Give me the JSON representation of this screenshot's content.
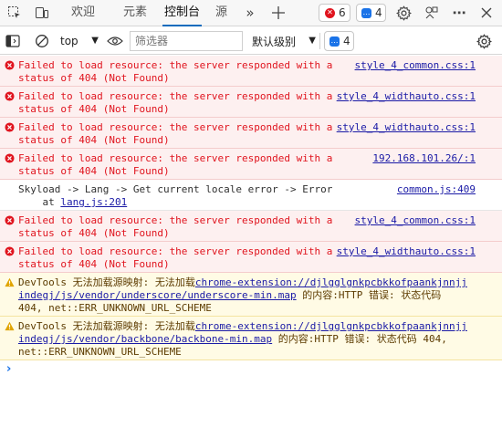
{
  "tabs": [
    {
      "label": "欢迎",
      "active": false
    },
    {
      "label": "元素",
      "active": false
    },
    {
      "label": "控制台",
      "active": true
    },
    {
      "label": "源",
      "active": false
    }
  ],
  "top_counts": {
    "errors": "6",
    "messages": "4"
  },
  "toolbar": {
    "context": "top",
    "filter_placeholder": "筛选器",
    "level": "默认级别",
    "issues": "4"
  },
  "messages": [
    {
      "kind": "error",
      "lines": [
        "Failed to load resource: the server responded with a",
        "status of 404 (Not Found)"
      ],
      "source": "style_4_common.css:1"
    },
    {
      "kind": "error",
      "lines": [
        "Failed to load resource: the server responded with a",
        "status of 404 (Not Found)"
      ],
      "source": "style_4_widthauto.css:1"
    },
    {
      "kind": "error",
      "lines": [
        "Failed to load resource: the server responded with a",
        "status of 404 (Not Found)"
      ],
      "source": "style_4_widthauto.css:1"
    },
    {
      "kind": "error",
      "lines": [
        "Failed to load resource: the server responded with a",
        "status of 404 (Not Found)"
      ],
      "source": "192.168.101.26/:1"
    },
    {
      "kind": "info",
      "line1": "Skyload -> Lang -> Get current locale error -> Error",
      "line2_prefix": "    at ",
      "line2_link": "lang.js:201",
      "source": "common.js:409"
    },
    {
      "kind": "error",
      "lines": [
        "Failed to load resource: the server responded with a",
        "status of 404 (Not Found)"
      ],
      "source": "style_4_common.css:1"
    },
    {
      "kind": "error",
      "lines": [
        "Failed to load resource: the server responded with a",
        "status of 404 (Not Found)"
      ],
      "source": "style_4_widthauto.css:1"
    },
    {
      "kind": "warning",
      "prefix": "DevTools 无法加载源映射: 无法加载",
      "link1": "chrome-extension://djlgglgnkpcbkkofpaankjnnjj",
      "link2": "indegj/js/vendor/underscore/underscore-min.map",
      "suffix": " 的内容:HTTP 错误: 状态代码",
      "line3": "404, net::ERR_UNKNOWN_URL_SCHEME"
    },
    {
      "kind": "warning",
      "prefix": "DevTools 无法加载源映射: 无法加载",
      "link1": "chrome-extension://djlgglgnkpcbkkofpaankjnnjj",
      "link2": "indegj/js/vendor/backbone/backbone-min.map",
      "suffix": " 的内容:HTTP 错误: 状态代码 404,",
      "line3": "net::ERR_UNKNOWN_URL_SCHEME"
    }
  ],
  "colors": {
    "error": "#e0141e",
    "warning": "#e0a400",
    "link": "#1a1aa6",
    "accent": "#0f6cbd"
  },
  "icons": [
    "device-toolbar-icon",
    "inspect-icon",
    "more-tabs-icon",
    "add-tab-icon",
    "settings-icon",
    "connect-icon",
    "close-icon",
    "sidebar-icon",
    "clear-icon",
    "eye-icon",
    "gear-icon"
  ]
}
